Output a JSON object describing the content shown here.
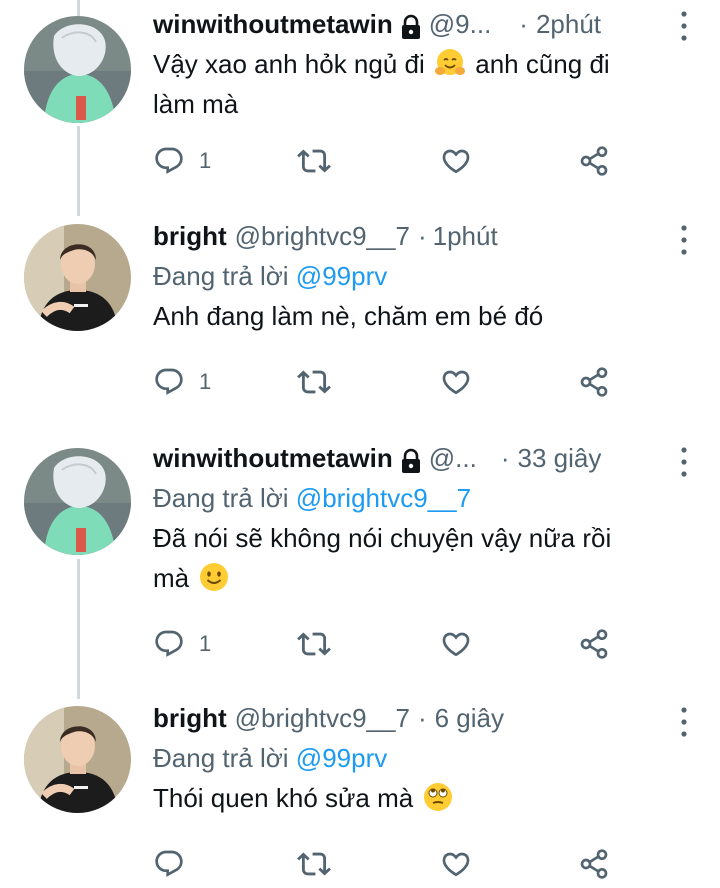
{
  "tweets": [
    {
      "display_name": "winwithoutmetawin",
      "handle": "@9...",
      "dot": "·",
      "time": "2phút",
      "replying_prefix": "",
      "replying_to": "",
      "text_parts": [
        "Vậy xao anh hỏk ngủ đi",
        "anh cũng đi",
        "làm mà"
      ],
      "emoji": "hugging-face",
      "reply_count": "1"
    },
    {
      "display_name": "bright",
      "handle": "@brightvc9__7",
      "dot": "·",
      "time": "1phút",
      "replying_prefix": "Đang trả lời",
      "replying_to": "@99prv",
      "text_parts": [
        "Anh đang làm nè, chăm em bé đó"
      ],
      "emoji": "",
      "reply_count": "1"
    },
    {
      "display_name": "winwithoutmetawin",
      "handle": "@...",
      "dot": "·",
      "time": "33 giây",
      "replying_prefix": "Đang trả lời",
      "replying_to": "@brightvc9__7",
      "text_parts": [
        "Đã nói sẽ không nói chuyện vậy nữa rồi",
        "mà"
      ],
      "emoji": "slightly-smiling-face",
      "reply_count": "1"
    },
    {
      "display_name": "bright",
      "handle": "@brightvc9__7",
      "dot": "·",
      "time": "6 giây",
      "replying_prefix": "Đang trả lời",
      "replying_to": "@99prv",
      "text_parts": [
        "Thói quen khó sửa mà"
      ],
      "emoji": "face-with-rolling-eyes",
      "reply_count": ""
    }
  ],
  "icons": {
    "reply": "reply-icon",
    "retweet": "retweet-icon",
    "like": "like-icon",
    "share": "share-icon",
    "more": "more-vertical-icon",
    "lock": "lock-icon"
  },
  "colors": {
    "text": "#0f1419",
    "secondary": "#536471",
    "link": "#1d9bf0",
    "thread_line": "#cfd9de"
  }
}
